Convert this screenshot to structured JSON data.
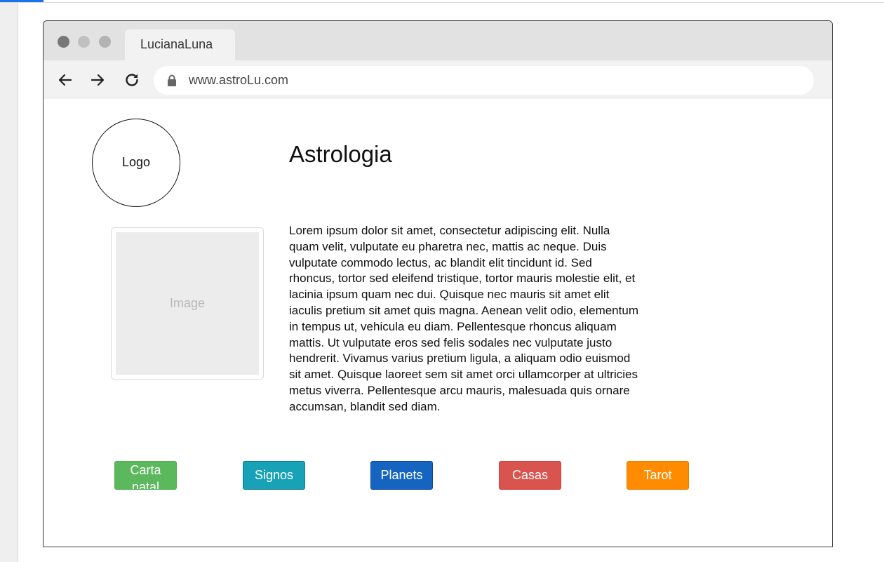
{
  "browser": {
    "tab_title": "LucianaLuna",
    "url": "www.astroLu.com"
  },
  "page": {
    "logo_label": "Logo",
    "title": "Astrologia",
    "image_placeholder": "Image",
    "body_text": "Lorem ipsum dolor sit amet, consectetur adipiscing elit. Nulla quam velit, vulputate eu pharetra nec, mattis ac neque. Duis vulputate commodo lectus, ac blandit elit tincidunt id. Sed rhoncus, tortor sed eleifend tristique, tortor mauris molestie elit, et lacinia ipsum quam nec dui. Quisque nec mauris sit amet elit iaculis pretium sit amet quis magna. Aenean velit odio, elementum in tempus ut, vehicula eu diam. Pellentesque rhoncus aliquam mattis. Ut vulputate eros sed felis sodales nec vulputate justo hendrerit. Vivamus varius pretium ligula, a aliquam odio euismod sit amet. Quisque laoreet sem sit amet orci ullamcorper at ultricies metus viverra. Pellentesque arcu mauris, malesuada quis ornare accumsan, blandit sed diam."
  },
  "buttons": [
    {
      "label": "Carta natal",
      "color": "#5cb85c"
    },
    {
      "label": "Signos",
      "color": "#17a2b8"
    },
    {
      "label": "Planets",
      "color": "#1565c0"
    },
    {
      "label": "Casas",
      "color": "#d9534f"
    },
    {
      "label": "Tarot",
      "color": "#ff8c00"
    }
  ],
  "icons": {
    "back": "arrow-left-icon",
    "forward": "arrow-right-icon",
    "reload": "reload-icon",
    "lock": "lock-icon"
  },
  "colors": {
    "accent": "#1a73e8",
    "titlebar": "#e2e2e2",
    "toolbar": "#f2f2f2"
  }
}
